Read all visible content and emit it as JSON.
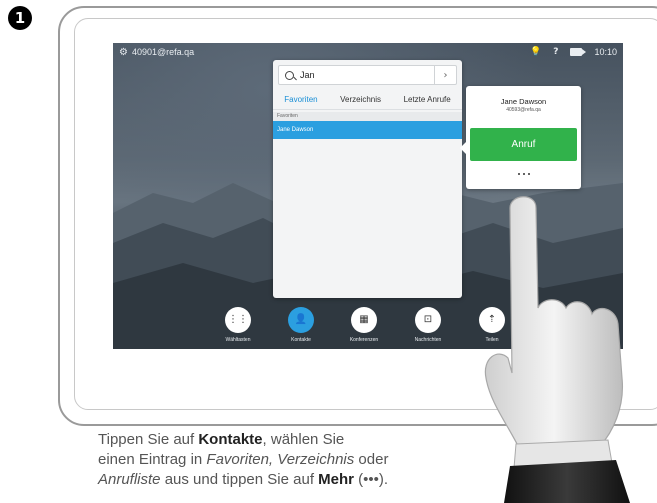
{
  "step": {
    "number": "1"
  },
  "status_bar": {
    "address": "40901@refa.qa",
    "time": "10:10",
    "icons": [
      "gear-icon",
      "bulb-icon",
      "help-icon",
      "camera-icon"
    ]
  },
  "contacts": {
    "search_value": "Jan",
    "tabs": [
      "Favoriten",
      "Verzeichnis",
      "Letzte Anrufe"
    ],
    "active_tab": "Favoriten",
    "section_label": "Favoriten",
    "rows": [
      "Jane Dawson"
    ]
  },
  "popover": {
    "name": "Jane Dawson",
    "address": "40593@refa.qa",
    "call_label": "Anruf"
  },
  "dock": {
    "items": [
      {
        "label": "Wähltasten",
        "icon": "keypad-icon"
      },
      {
        "label": "Kontakte",
        "icon": "contacts-icon"
      },
      {
        "label": "Konferenzen",
        "icon": "calendar-icon"
      },
      {
        "label": "Nachrichten",
        "icon": "voicemail-icon"
      },
      {
        "label": "Teilen",
        "icon": "share-icon"
      }
    ]
  },
  "caption": {
    "line1_pre": "Tippen Sie auf ",
    "line1_bold": "Kontakte",
    "line1_post": ", wählen Sie",
    "line2_pre": "einen Eintrag in ",
    "line2_italic": "Favoriten, Verzeichnis",
    "line2_post": " oder",
    "line3_italic": "Anrufliste",
    "line3_mid": " aus und tippen Sie auf ",
    "line3_bold": "Mehr",
    "line3_post": " (•••)."
  },
  "colors": {
    "accent": "#2b9fe0",
    "call_green": "#31b24b"
  }
}
